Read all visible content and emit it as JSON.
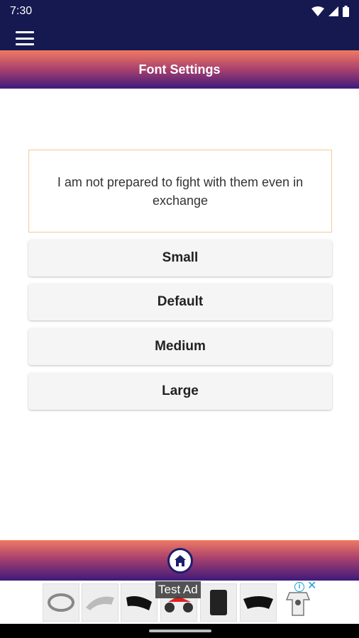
{
  "status_bar": {
    "time": "7:30",
    "icons": [
      "wifi-icon",
      "cell-signal-icon",
      "battery-icon"
    ]
  },
  "toolbar": {
    "menu_icon": "hamburger-menu-icon"
  },
  "header": {
    "title": "Font Settings"
  },
  "preview": {
    "text": "I am not prepared to fight with them even in exchange"
  },
  "font_sizes": [
    {
      "label": "Small"
    },
    {
      "label": "Default"
    },
    {
      "label": "Medium"
    },
    {
      "label": "Large"
    }
  ],
  "bottom_bar": {
    "home_icon": "home-icon"
  },
  "ad": {
    "label": "Test Ad",
    "info_icon": "ad-info-icon",
    "close_icon": "ad-close-icon"
  },
  "colors": {
    "dark_navy": "#161850",
    "gradient_top": "#f07a62",
    "gradient_bottom": "#3d1a7a",
    "preview_border": "#f6c99f",
    "button_bg": "#f5f5f5"
  }
}
